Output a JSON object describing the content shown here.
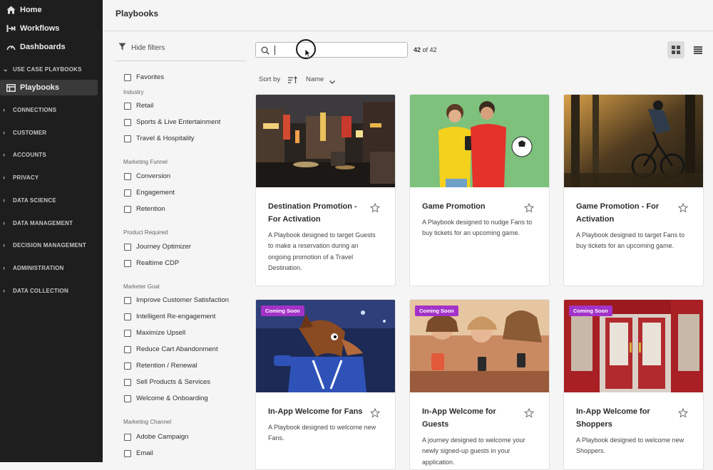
{
  "nav": {
    "home": "Home",
    "workflows": "Workflows",
    "dashboards": "Dashboards",
    "use_case_section": "USE CASE PLAYBOOKS",
    "playbooks": "Playbooks",
    "sections": [
      "CONNECTIONS",
      "CUSTOMER",
      "ACCOUNTS",
      "PRIVACY",
      "DATA SCIENCE",
      "DATA MANAGEMENT",
      "DECISION MANAGEMENT",
      "ADMINISTRATION",
      "DATA COLLECTION"
    ]
  },
  "header": {
    "title": "Playbooks"
  },
  "filters": {
    "hide_label": "Hide filters",
    "favorites": "Favorites",
    "industry_label": "Industry",
    "industry": [
      "Retail",
      "Sports & Live Entertainment",
      "Travel & Hospitality"
    ],
    "funnel_label": "Marketing Funnel",
    "funnel": [
      "Conversion",
      "Engagement",
      "Retention"
    ],
    "product_label": "Product Required",
    "product": [
      "Journey Optimizer",
      "Realtime CDP"
    ],
    "goal_label": "Marketer Goal",
    "goal": [
      "Improve Customer Satisfaction",
      "Intelligent Re-engagement",
      "Maximize Upsell",
      "Reduce Cart Abandonment",
      "Retention / Renewal",
      "Sell Products & Services",
      "Welcome & Onboarding"
    ],
    "channel_label": "Marketing Channel",
    "channel": [
      "Adobe Campaign",
      "Email"
    ]
  },
  "search": {
    "value": "",
    "placeholder": ""
  },
  "results": {
    "shown": "42",
    "of_text": "of 42"
  },
  "sort": {
    "label": "Sort by",
    "value": "Name"
  },
  "badge_text": "Coming Soon",
  "cards": [
    {
      "title_line1": "Destination Promotion -",
      "title_line2": "For Activation",
      "desc": [
        "A Playbook designed to target Guests",
        "to make a reservation during an",
        "ongoing promotion of a Travel",
        "Destination."
      ]
    },
    {
      "title_line1": "Game Promotion",
      "title_line2": "",
      "desc": [
        "A Playbook designed to nudge Fans to",
        "buy tickets for an upcoming game."
      ]
    },
    {
      "title_line1": "Game Promotion - For",
      "title_line2": "Activation",
      "desc": [
        "A Playbook designed to target Fans to",
        "buy tickets for an upcoming game."
      ]
    },
    {
      "title_line1": "In-App Welcome for Fans",
      "title_line2": "",
      "desc": [
        "A Playbook designed to welcome new",
        "Fans."
      ]
    },
    {
      "title_line1": "In-App Welcome for",
      "title_line2": "Guests",
      "desc": [
        "A journey designed to welcome your",
        "newly signed-up guests in your",
        "application."
      ]
    },
    {
      "title_line1": "In-App Welcome for",
      "title_line2": "Shoppers",
      "desc": [
        "A Playbook designed to welcome new",
        "Shoppers."
      ]
    }
  ],
  "colors": {
    "nav_bg": "#1e1e1e",
    "badge": "#a333c8",
    "page_bg": "#f5f5f5"
  }
}
